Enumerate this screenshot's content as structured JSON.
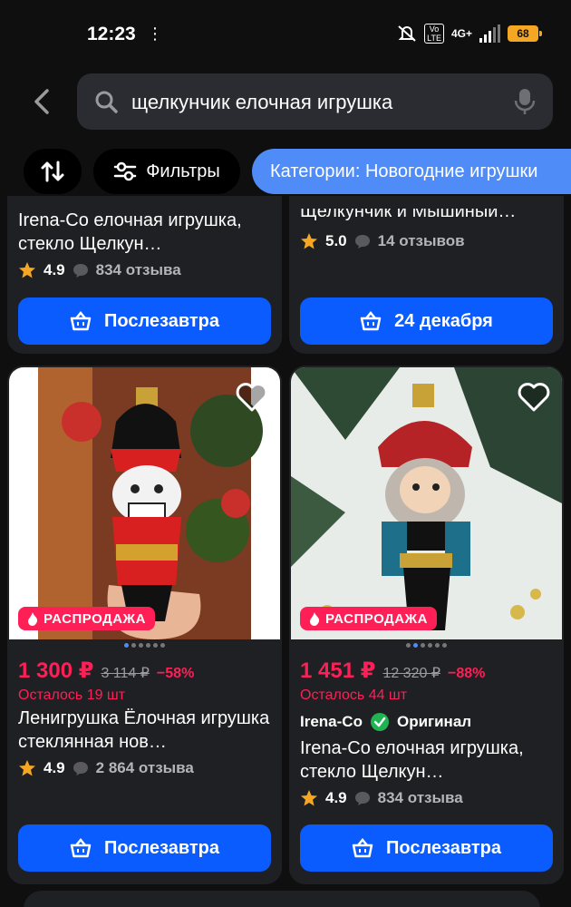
{
  "status_bar": {
    "time": "12:23",
    "network": "4G+",
    "volte": "Vo\nLTE",
    "battery": "68"
  },
  "search": {
    "query": "щелкунчик елочная игрушка"
  },
  "chips": {
    "filters_label": "Фильтры",
    "category_label": "Категории: Новогодние игрушки"
  },
  "products": [
    {
      "title": "Irena-Co елочная игрушка, стекло Щелкун…",
      "rating": "4.9",
      "reviews": "834 отзыва",
      "delivery": "Послезавтра"
    },
    {
      "title": "Щелкунчик и Мышиный…",
      "rating": "5.0",
      "reviews": "14 отзывов",
      "delivery": "24 декабря"
    },
    {
      "badge": "РАСПРОДАЖА",
      "price": "1 300 ₽",
      "old_price": "3 114 ₽",
      "discount": "−58%",
      "stock": "Осталось 19 шт",
      "title": "Ленигрушка Ёлочная игрушка стеклянная нов…",
      "rating": "4.9",
      "reviews": "2 864 отзыва",
      "delivery": "Послезавтра"
    },
    {
      "badge": "РАСПРОДАЖА",
      "price": "1 451 ₽",
      "old_price": "12 320 ₽",
      "discount": "−88%",
      "stock": "Осталось 44 шт",
      "brand": "Irena-Co",
      "brand_tag": "Оригинал",
      "title": "Irena-Co елочная игрушка, стекло Щелкун…",
      "rating": "4.9",
      "reviews": "834 отзыва",
      "delivery": "Послезавтра"
    }
  ],
  "colors": {
    "accent_blue": "#0a5cff",
    "sale_red": "#ff1f57",
    "chip_blue": "#4f8cf7",
    "card_bg": "#1f2023"
  }
}
